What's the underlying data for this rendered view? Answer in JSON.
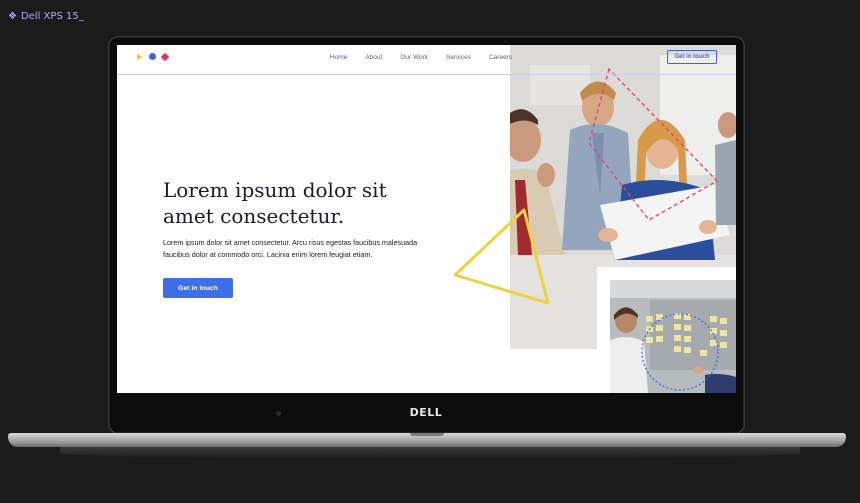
{
  "frame": {
    "label": "Dell XPS 15_"
  },
  "device": {
    "brand": "DELL"
  },
  "site": {
    "nav": {
      "items": [
        {
          "label": "Home",
          "active": true
        },
        {
          "label": "About",
          "active": false
        },
        {
          "label": "Our Work",
          "active": false
        },
        {
          "label": "Services",
          "active": false
        },
        {
          "label": "Careers",
          "active": false
        }
      ],
      "cta_label": "Get in touch"
    },
    "hero": {
      "title": "Lorem ipsum dolor sit amet consectetur.",
      "body": "Lorem ipsum dolor sit amet consectetur. Arcu risus egestas faucibus malesuada faucibus dolor at commodo orci. Lacinia enim lorem feugiat etiam.",
      "cta_label": "Get in touch"
    }
  },
  "colors": {
    "accent": "#3e63dd",
    "cta": "#3e6fe8",
    "logo_yellow": "#f0c531",
    "logo_pink": "#e2345f",
    "triangle_yellow": "#f2cf43",
    "dashed_pink": "#e0457b",
    "frame_label": "#b9a6ff"
  }
}
